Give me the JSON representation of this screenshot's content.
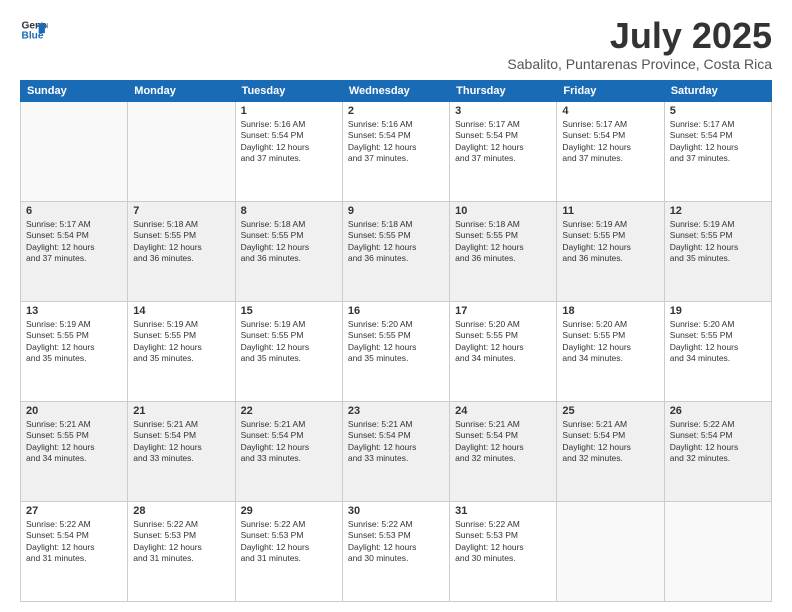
{
  "header": {
    "logo_line1": "General",
    "logo_line2": "Blue",
    "month_year": "July 2025",
    "location": "Sabalito, Puntarenas Province, Costa Rica"
  },
  "weekdays": [
    "Sunday",
    "Monday",
    "Tuesday",
    "Wednesday",
    "Thursday",
    "Friday",
    "Saturday"
  ],
  "weeks": [
    [
      {
        "day": "",
        "text": ""
      },
      {
        "day": "",
        "text": ""
      },
      {
        "day": "1",
        "text": "Sunrise: 5:16 AM\nSunset: 5:54 PM\nDaylight: 12 hours\nand 37 minutes."
      },
      {
        "day": "2",
        "text": "Sunrise: 5:16 AM\nSunset: 5:54 PM\nDaylight: 12 hours\nand 37 minutes."
      },
      {
        "day": "3",
        "text": "Sunrise: 5:17 AM\nSunset: 5:54 PM\nDaylight: 12 hours\nand 37 minutes."
      },
      {
        "day": "4",
        "text": "Sunrise: 5:17 AM\nSunset: 5:54 PM\nDaylight: 12 hours\nand 37 minutes."
      },
      {
        "day": "5",
        "text": "Sunrise: 5:17 AM\nSunset: 5:54 PM\nDaylight: 12 hours\nand 37 minutes."
      }
    ],
    [
      {
        "day": "6",
        "text": "Sunrise: 5:17 AM\nSunset: 5:54 PM\nDaylight: 12 hours\nand 37 minutes."
      },
      {
        "day": "7",
        "text": "Sunrise: 5:18 AM\nSunset: 5:55 PM\nDaylight: 12 hours\nand 36 minutes."
      },
      {
        "day": "8",
        "text": "Sunrise: 5:18 AM\nSunset: 5:55 PM\nDaylight: 12 hours\nand 36 minutes."
      },
      {
        "day": "9",
        "text": "Sunrise: 5:18 AM\nSunset: 5:55 PM\nDaylight: 12 hours\nand 36 minutes."
      },
      {
        "day": "10",
        "text": "Sunrise: 5:18 AM\nSunset: 5:55 PM\nDaylight: 12 hours\nand 36 minutes."
      },
      {
        "day": "11",
        "text": "Sunrise: 5:19 AM\nSunset: 5:55 PM\nDaylight: 12 hours\nand 36 minutes."
      },
      {
        "day": "12",
        "text": "Sunrise: 5:19 AM\nSunset: 5:55 PM\nDaylight: 12 hours\nand 35 minutes."
      }
    ],
    [
      {
        "day": "13",
        "text": "Sunrise: 5:19 AM\nSunset: 5:55 PM\nDaylight: 12 hours\nand 35 minutes."
      },
      {
        "day": "14",
        "text": "Sunrise: 5:19 AM\nSunset: 5:55 PM\nDaylight: 12 hours\nand 35 minutes."
      },
      {
        "day": "15",
        "text": "Sunrise: 5:19 AM\nSunset: 5:55 PM\nDaylight: 12 hours\nand 35 minutes."
      },
      {
        "day": "16",
        "text": "Sunrise: 5:20 AM\nSunset: 5:55 PM\nDaylight: 12 hours\nand 35 minutes."
      },
      {
        "day": "17",
        "text": "Sunrise: 5:20 AM\nSunset: 5:55 PM\nDaylight: 12 hours\nand 34 minutes."
      },
      {
        "day": "18",
        "text": "Sunrise: 5:20 AM\nSunset: 5:55 PM\nDaylight: 12 hours\nand 34 minutes."
      },
      {
        "day": "19",
        "text": "Sunrise: 5:20 AM\nSunset: 5:55 PM\nDaylight: 12 hours\nand 34 minutes."
      }
    ],
    [
      {
        "day": "20",
        "text": "Sunrise: 5:21 AM\nSunset: 5:55 PM\nDaylight: 12 hours\nand 34 minutes."
      },
      {
        "day": "21",
        "text": "Sunrise: 5:21 AM\nSunset: 5:54 PM\nDaylight: 12 hours\nand 33 minutes."
      },
      {
        "day": "22",
        "text": "Sunrise: 5:21 AM\nSunset: 5:54 PM\nDaylight: 12 hours\nand 33 minutes."
      },
      {
        "day": "23",
        "text": "Sunrise: 5:21 AM\nSunset: 5:54 PM\nDaylight: 12 hours\nand 33 minutes."
      },
      {
        "day": "24",
        "text": "Sunrise: 5:21 AM\nSunset: 5:54 PM\nDaylight: 12 hours\nand 32 minutes."
      },
      {
        "day": "25",
        "text": "Sunrise: 5:21 AM\nSunset: 5:54 PM\nDaylight: 12 hours\nand 32 minutes."
      },
      {
        "day": "26",
        "text": "Sunrise: 5:22 AM\nSunset: 5:54 PM\nDaylight: 12 hours\nand 32 minutes."
      }
    ],
    [
      {
        "day": "27",
        "text": "Sunrise: 5:22 AM\nSunset: 5:54 PM\nDaylight: 12 hours\nand 31 minutes."
      },
      {
        "day": "28",
        "text": "Sunrise: 5:22 AM\nSunset: 5:53 PM\nDaylight: 12 hours\nand 31 minutes."
      },
      {
        "day": "29",
        "text": "Sunrise: 5:22 AM\nSunset: 5:53 PM\nDaylight: 12 hours\nand 31 minutes."
      },
      {
        "day": "30",
        "text": "Sunrise: 5:22 AM\nSunset: 5:53 PM\nDaylight: 12 hours\nand 30 minutes."
      },
      {
        "day": "31",
        "text": "Sunrise: 5:22 AM\nSunset: 5:53 PM\nDaylight: 12 hours\nand 30 minutes."
      },
      {
        "day": "",
        "text": ""
      },
      {
        "day": "",
        "text": ""
      }
    ]
  ]
}
